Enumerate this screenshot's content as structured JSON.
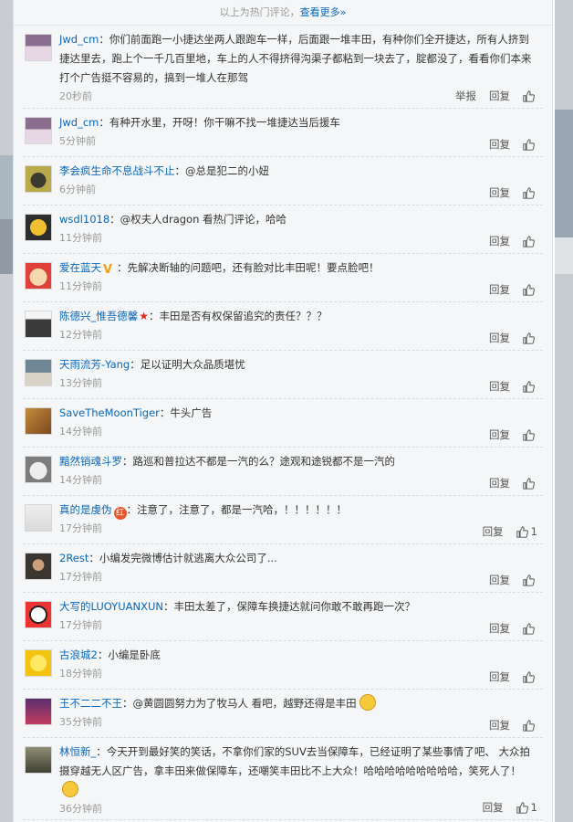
{
  "header": {
    "prefix": "以上为热门评论，",
    "more_link": "查看更多»"
  },
  "actions": {
    "report": "举报",
    "reply": "回复"
  },
  "comments": [
    {
      "user": "Jwd_cm",
      "text": "：你们前面跑一小捷达坐两人跟跑车一样，后面跟一堆丰田，有种你们全开捷达，所有人挤到捷达里去，跑上个一千几百里地，车上的人不得挤得沟渠子都粘到一块去了，腚都没了，看看你们本来打个广告挺不容易的，搞到一堆人在那驾",
      "time": "20秒前",
      "report": true,
      "likes": ""
    },
    {
      "user": "Jwd_cm",
      "text": "：有种开水里，开呀！你干嘛不找一堆捷达当后援车",
      "time": "5分钟前",
      "likes": ""
    },
    {
      "user": "李会疯生命不息战斗不止",
      "text": "：@总是犯二的小妞",
      "time": "6分钟前",
      "likes": ""
    },
    {
      "user": "wsdl1018",
      "text": "：@权夫人dragon 看热门评论，哈哈",
      "time": "11分钟前",
      "likes": ""
    },
    {
      "user": "爱在蓝天",
      "text": "：先解决断轴的问题吧，还有脸对比丰田呢！要点脸吧！",
      "time": "11分钟前",
      "likes": "",
      "badge": "V"
    },
    {
      "user": "陈德兴_惟吾德馨",
      "text": "：丰田是否有权保留追究的责任？？？",
      "time": "12分钟前",
      "likes": "",
      "badge": "★"
    },
    {
      "user": "天雨流芳-Yang",
      "text": "：足以证明大众品质堪忧",
      "time": "13分钟前",
      "likes": ""
    },
    {
      "user": "SaveTheMoonTiger",
      "text": "：牛头广告",
      "time": "14分钟前",
      "likes": ""
    },
    {
      "user": "黯然销魂斗罗",
      "text": "：路巡和普拉达不都是一汽的么？途观和途锐都不是一汽的",
      "time": "14分钟前",
      "likes": ""
    },
    {
      "user": "真的是虔伪",
      "text": "：注意了，注意了，都是一汽哈，！！！！！！",
      "time": "17分钟前",
      "likes": "1",
      "badge": "红"
    },
    {
      "user": "2Rest",
      "text": "：小编发完微博估计就逃离大众公司了...",
      "time": "17分钟前",
      "likes": ""
    },
    {
      "user": "大写的LUOYUANXUN",
      "text": "：丰田太差了，保障车换捷达就问你敢不敢再跑一次？",
      "time": "17分钟前",
      "likes": ""
    },
    {
      "user": "古浪城2",
      "text": "：小编是卧底",
      "time": "18分钟前",
      "likes": ""
    },
    {
      "user": "王不二二不王",
      "text": "：@黄圆圆努力为了牧马人 看吧，越野还得是丰田",
      "time": "35分钟前",
      "likes": ""
    },
    {
      "user": "林恒新_",
      "text": "：今天开到最好笑的笑话，不拿你们家的SUV去当保障车，已经证明了某些事情了吧、 大众拍摄穿越无人区广告，拿丰田来做保障车，还嘲笑丰田比不上大众！哈哈哈哈哈哈哈哈哈，笑死人了！",
      "time": "36分钟前",
      "likes": "1"
    }
  ],
  "colors": {
    "link": "#0a66b7",
    "panel_bg": "#f4f6f7",
    "meta": "#999999"
  }
}
